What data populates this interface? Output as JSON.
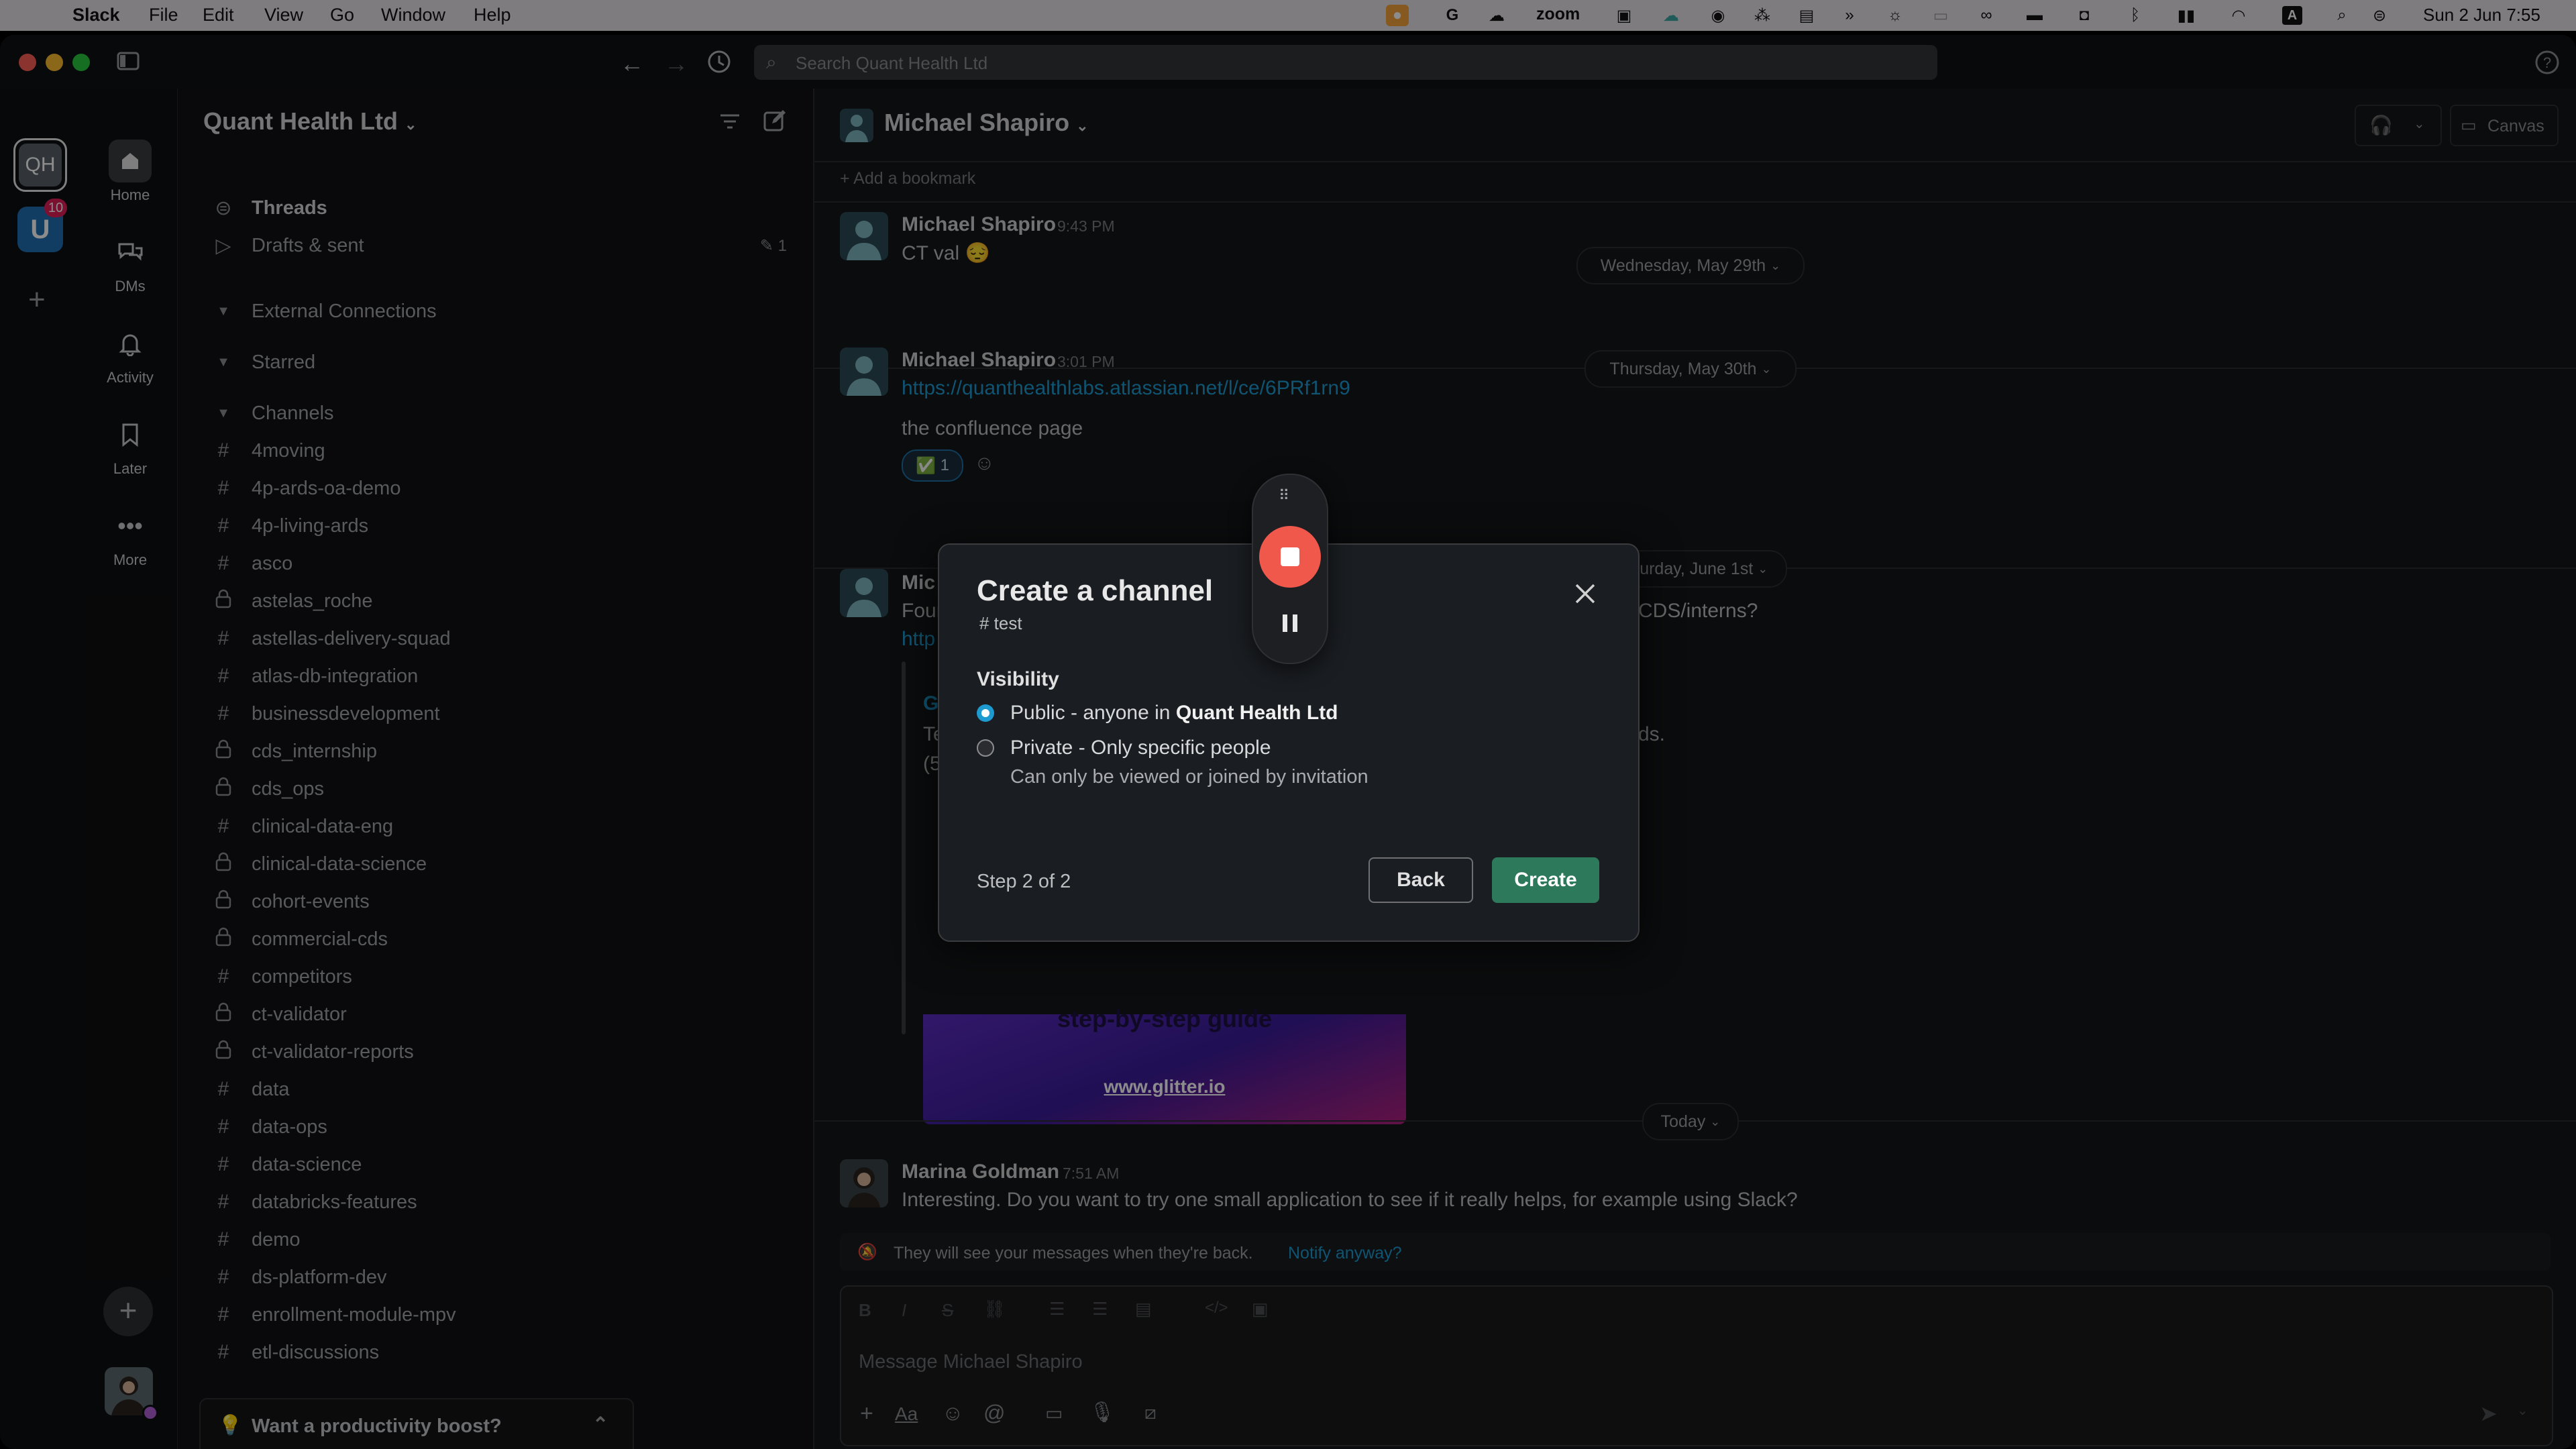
{
  "menubar": {
    "apple": "",
    "app": "Slack",
    "menus": [
      "File",
      "Edit",
      "View",
      "Go",
      "Window",
      "Help"
    ],
    "zoom": "zoom",
    "clock": "Sun 2 Jun  7:55"
  },
  "titlebar": {
    "search_placeholder": "Search Quant Health Ltd"
  },
  "workspace_rail": {
    "workspace_initials": "QH",
    "second_badge": "10"
  },
  "nav": {
    "home": "Home",
    "dms": "DMs",
    "activity": "Activity",
    "later": "Later",
    "more": "More"
  },
  "sidebar": {
    "workspace_name": "Quant Health Ltd",
    "threads": "Threads",
    "drafts": "Drafts & sent",
    "drafts_count": "1",
    "sections": {
      "external": "External Connections",
      "starred": "Starred",
      "channels": "Channels"
    },
    "channels": [
      {
        "name": "4moving",
        "private": false
      },
      {
        "name": "4p-ards-oa-demo",
        "private": false
      },
      {
        "name": "4p-living-ards",
        "private": false
      },
      {
        "name": "asco",
        "private": false
      },
      {
        "name": "astelas_roche",
        "private": true
      },
      {
        "name": "astellas-delivery-squad",
        "private": false
      },
      {
        "name": "atlas-db-integration",
        "private": false
      },
      {
        "name": "businessdevelopment",
        "private": false
      },
      {
        "name": "cds_internship",
        "private": true
      },
      {
        "name": "cds_ops",
        "private": true
      },
      {
        "name": "clinical-data-eng",
        "private": false
      },
      {
        "name": "clinical-data-science",
        "private": true
      },
      {
        "name": "cohort-events",
        "private": true
      },
      {
        "name": "commercial-cds",
        "private": true
      },
      {
        "name": "competitors",
        "private": false
      },
      {
        "name": "ct-validator",
        "private": true
      },
      {
        "name": "ct-validator-reports",
        "private": true
      },
      {
        "name": "data",
        "private": false
      },
      {
        "name": "data-ops",
        "private": false
      },
      {
        "name": "data-science",
        "private": false
      },
      {
        "name": "databricks-features",
        "private": false
      },
      {
        "name": "demo",
        "private": false
      },
      {
        "name": "ds-platform-dev",
        "private": false
      },
      {
        "name": "enrollment-module-mpv",
        "private": false
      },
      {
        "name": "etl-discussions",
        "private": false
      }
    ],
    "productivity": "Want a productivity boost?"
  },
  "header": {
    "dm_name": "Michael Shapiro",
    "canvas": "Canvas",
    "add_bookmark": "Add a bookmark"
  },
  "messages": {
    "m1": {
      "author": "Michael Shapiro",
      "time": "9:43 PM",
      "text": "CT val"
    },
    "m2": {
      "author": "Michael Shapiro",
      "time": "3:01 PM",
      "link": "https://quanthealthlabs.atlassian.net/l/ce/6PRf1rn9",
      "text": "the confluence page",
      "reaction_count": "1"
    },
    "m3": {
      "author": "Mic",
      "line1_start": "Four",
      "line1_end": "CDS/interns?",
      "line2": "http",
      "embed_g": "Gl",
      "embed_t": "Te",
      "embed_t_end": "ds.",
      "embed_5": "(5",
      "guide": "step-by-step guide",
      "guide_link": "www.glitter.io"
    },
    "m4": {
      "author": "Marina Goldman",
      "time": "7:51 AM",
      "text": "Interesting. Do you want to try one small application to see if it really helps, for example using Slack?"
    }
  },
  "dates": {
    "d1": "Wednesday, May 29th",
    "d2": "Thursday, May 30th",
    "d3": "Saturday, June 1st",
    "d4": "Today"
  },
  "notice": {
    "text": "They will see your messages when they're back.",
    "link": "Notify anyway?"
  },
  "composer": {
    "placeholder": "Message Michael Shapiro",
    "aa": "Aa"
  },
  "modal": {
    "title": "Create a channel",
    "channel": "# test",
    "visibility_label": "Visibility",
    "public_prefix": "Public - anyone in ",
    "public_workspace": "Quant Health Ltd",
    "private_label": "Private - Only specific people",
    "private_help": "Can only be viewed or joined by invitation",
    "step": "Step 2 of 2",
    "back": "Back",
    "create": "Create",
    "selected": "public"
  },
  "colors": {
    "accent_green": "#2c7a5b",
    "link_blue": "#1d9bd1",
    "record_red": "#f0584b"
  }
}
